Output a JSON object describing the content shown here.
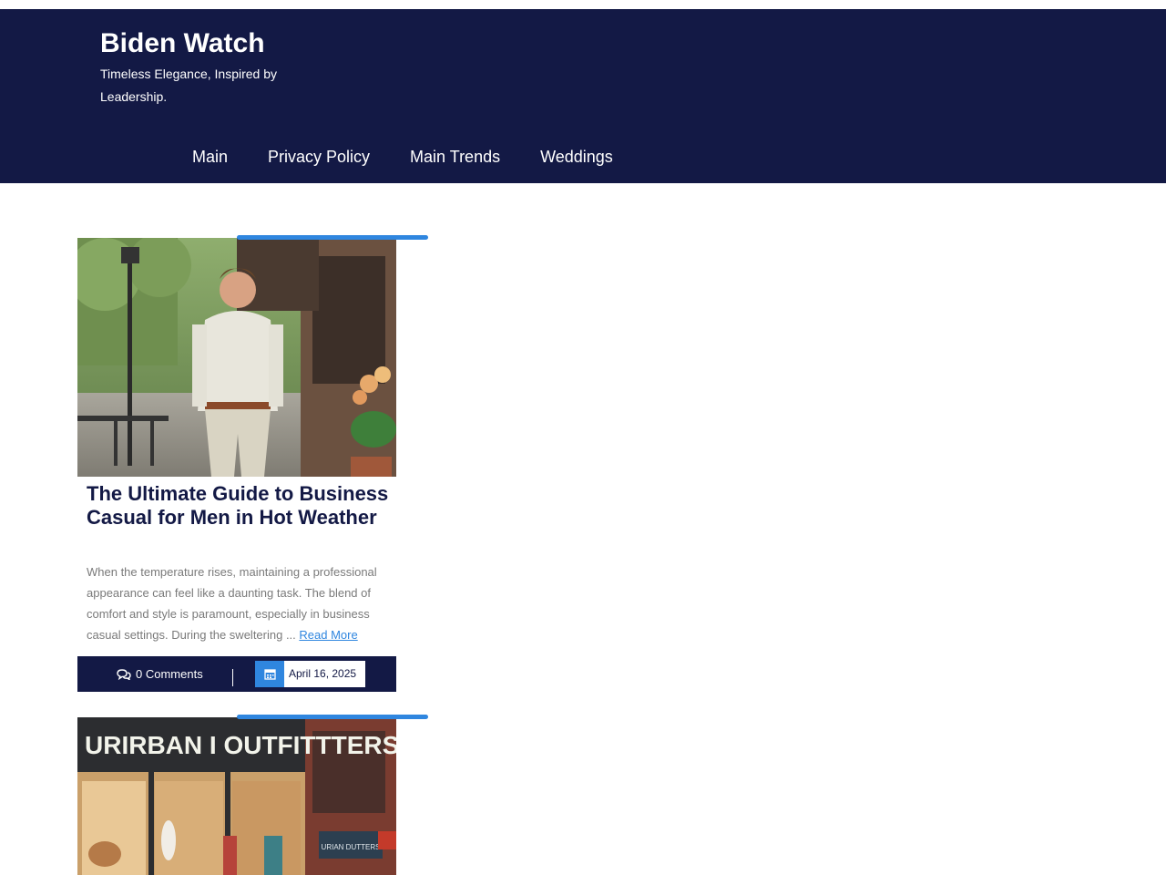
{
  "site": {
    "title": "Biden Watch",
    "tagline": "Timeless Elegance, Inspired by Leadership."
  },
  "nav": {
    "items": [
      {
        "label": "Main"
      },
      {
        "label": "Privacy Policy"
      },
      {
        "label": "Main Trends"
      },
      {
        "label": "Weddings"
      }
    ]
  },
  "colors": {
    "header_bg": "#131945",
    "accent": "#2f86df",
    "title_text": "#131945",
    "excerpt_text": "#7a7a7a"
  },
  "posts": [
    {
      "image_desc": "man-in-business-casual-street-photo",
      "title": "The Ultimate Guide to Business Casual for Men in Hot Weather",
      "excerpt": "When the temperature rises, maintaining a professional appearance can feel like a daunting task. The blend of comfort and style is paramount, especially in business casual settings. During the sweltering ...",
      "read_more": "Read More",
      "comments": "0 Comments",
      "date": "April 16, 2025"
    },
    {
      "image_desc": "urban-outfitters-storefront-photo",
      "sign_text": "URIRBAN I OUTFITTTERS"
    }
  ]
}
